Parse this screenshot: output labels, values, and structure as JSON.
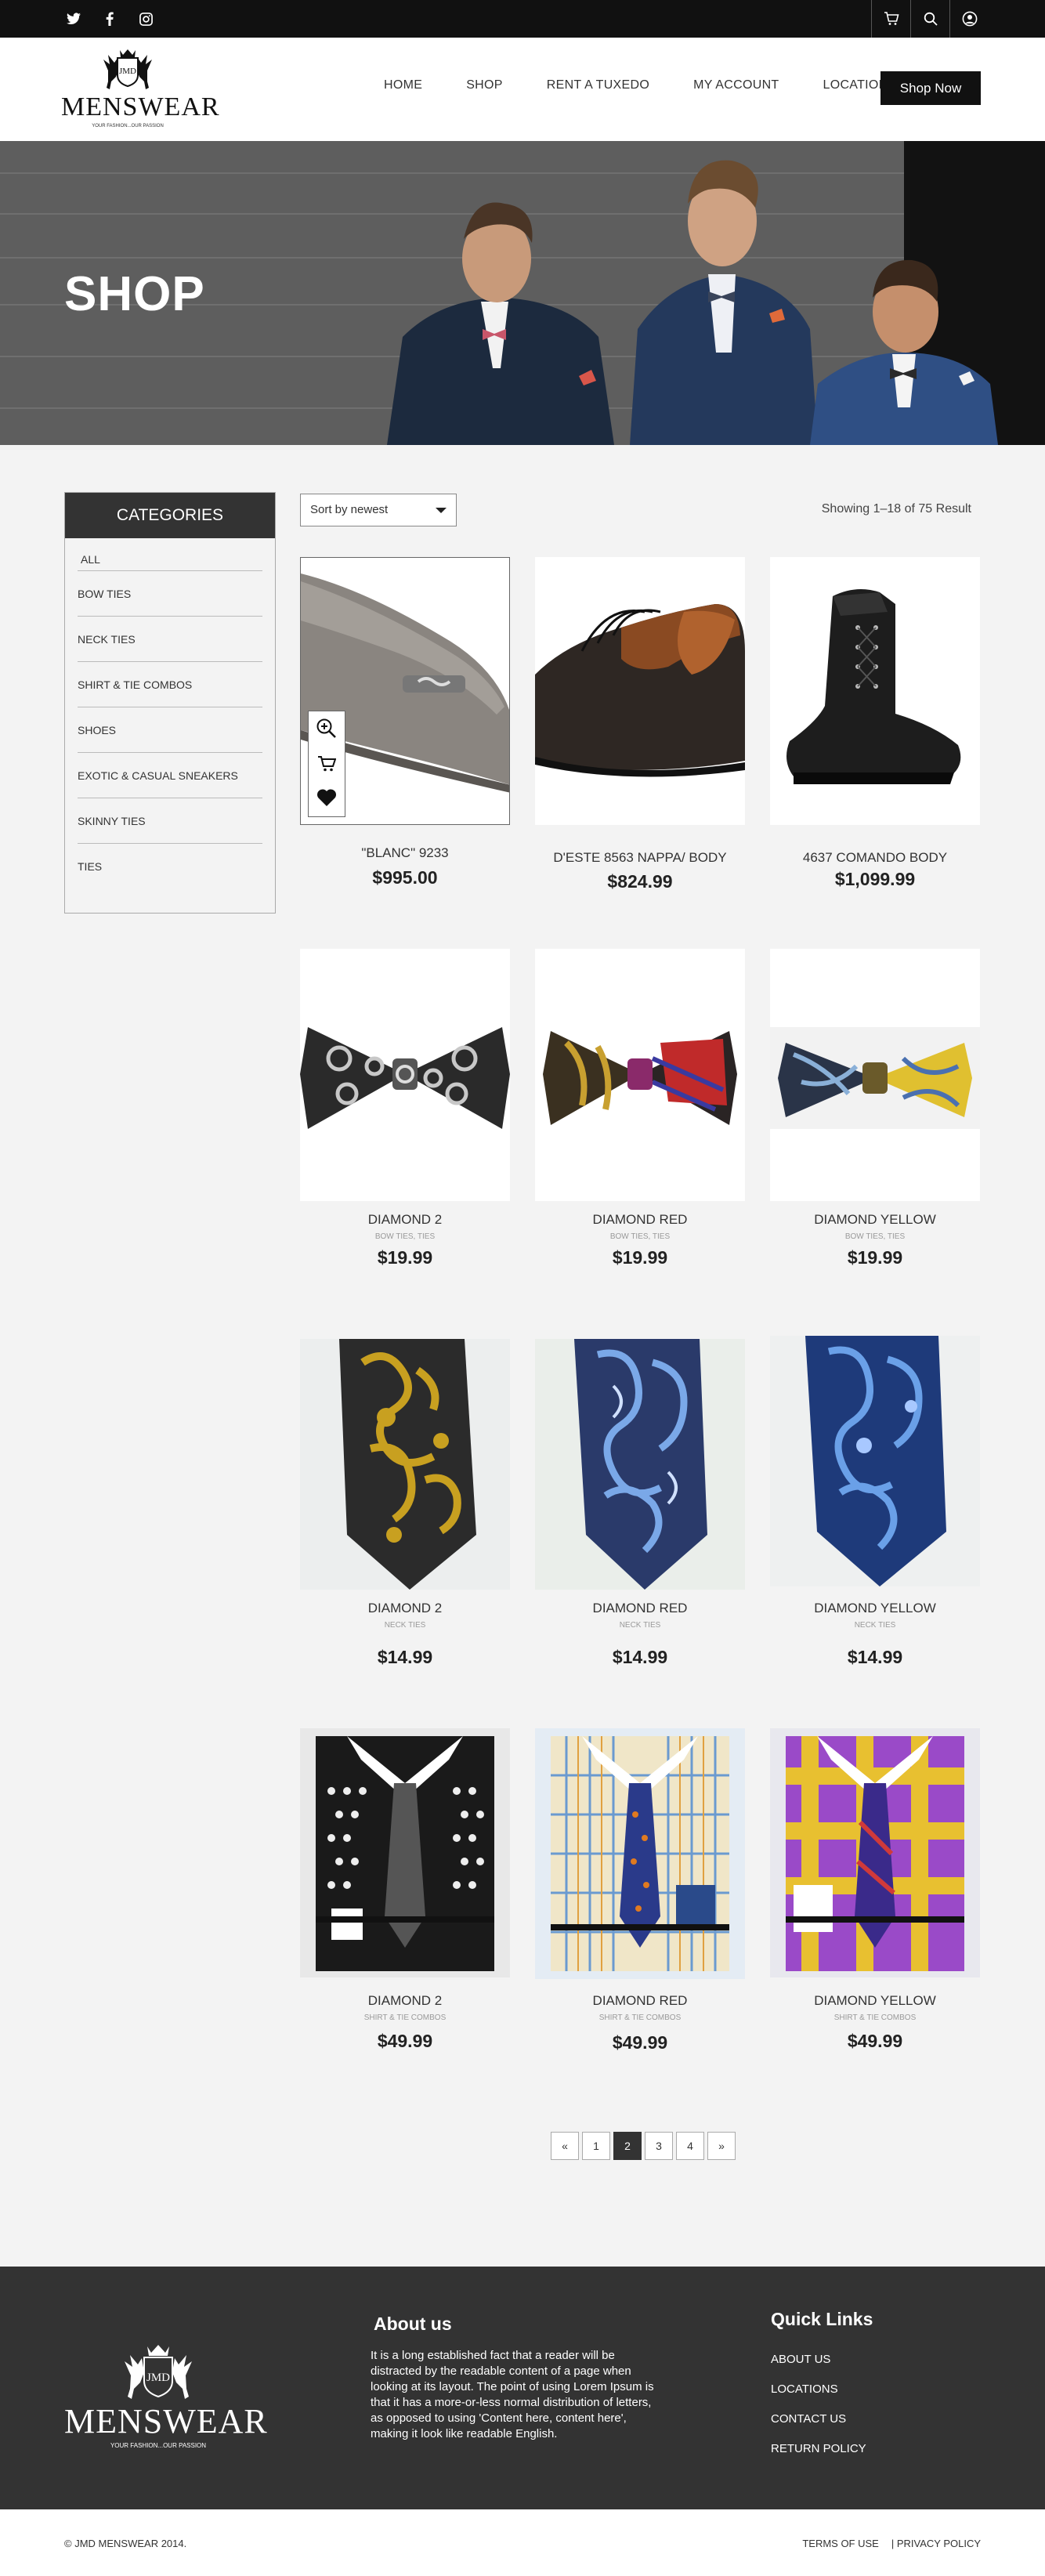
{
  "header": {
    "nav": [
      "HOME",
      "SHOP",
      "RENT A TUXEDO",
      "MY ACCOUNT",
      "LOCATIONS"
    ],
    "cta": "Shop Now",
    "logo_text": "MENSWEAR",
    "logo_monogram": "JMD",
    "logo_tagline": "YOUR FASHION...OUR PASSION"
  },
  "hero": {
    "title": "SHOP"
  },
  "sidebar": {
    "title": "CATEGORIES",
    "items": [
      "ALL",
      "BOW TIES",
      "NECK TIES",
      "SHIRT & TIE COMBOS",
      "SHOES",
      "EXOTIC & CASUAL SNEAKERS",
      "SKINNY TIES",
      "TIES"
    ]
  },
  "toolbar": {
    "sort": "Sort by newest",
    "showing": "Showing  1–18 of  75  Result"
  },
  "products": [
    {
      "name": "\"BLANC\" 9233",
      "cat": "",
      "price": "$995.00"
    },
    {
      "name": "D'ESTE 8563 NAPPA/ BODY",
      "cat": "",
      "price": "$824.99"
    },
    {
      "name": "4637 COMANDO BODY",
      "cat": "",
      "price": "$1,099.99"
    },
    {
      "name": "DIAMOND 2",
      "cat": "BOW TIES, TIES",
      "price": "$19.99"
    },
    {
      "name": "DIAMOND RED",
      "cat": "BOW TIES, TIES",
      "price": "$19.99"
    },
    {
      "name": "DIAMOND YELLOW",
      "cat": "BOW TIES, TIES",
      "price": "$19.99"
    },
    {
      "name": "DIAMOND 2",
      "cat": "NECK TIES",
      "price": "$14.99"
    },
    {
      "name": "DIAMOND RED",
      "cat": "NECK TIES",
      "price": "$14.99"
    },
    {
      "name": "DIAMOND YELLOW",
      "cat": "NECK TIES",
      "price": "$14.99"
    },
    {
      "name": "DIAMOND 2",
      "cat": "SHIRT & TIE COMBOS",
      "price": "$49.99"
    },
    {
      "name": "DIAMOND RED",
      "cat": "SHIRT & TIE COMBOS",
      "price": "$49.99"
    },
    {
      "name": "DIAMOND YELLOW",
      "cat": "SHIRT & TIE COMBOS",
      "price": "$49.99"
    }
  ],
  "pagination": [
    "«",
    "1",
    "2",
    "3",
    "4",
    "»"
  ],
  "footer": {
    "about_title": "About us",
    "about_text": "It is a long established fact that a reader will be distracted by the readable content of a page when looking at its layout. The point of using Lorem Ipsum is that it has a more-or-less normal distribution of letters, as opposed to using 'Content here, content here', making it look like readable English.",
    "quick_title": "Quick Links",
    "quick_links": [
      "ABOUT US",
      "LOCATIONS",
      "CONTACT US",
      "RETURN POLICY"
    ]
  },
  "bottom": {
    "copyright": "© JMD MENSWEAR 2014.",
    "terms": "TERMS OF USE",
    "privacy": "|  PRIVACY POLICY"
  }
}
